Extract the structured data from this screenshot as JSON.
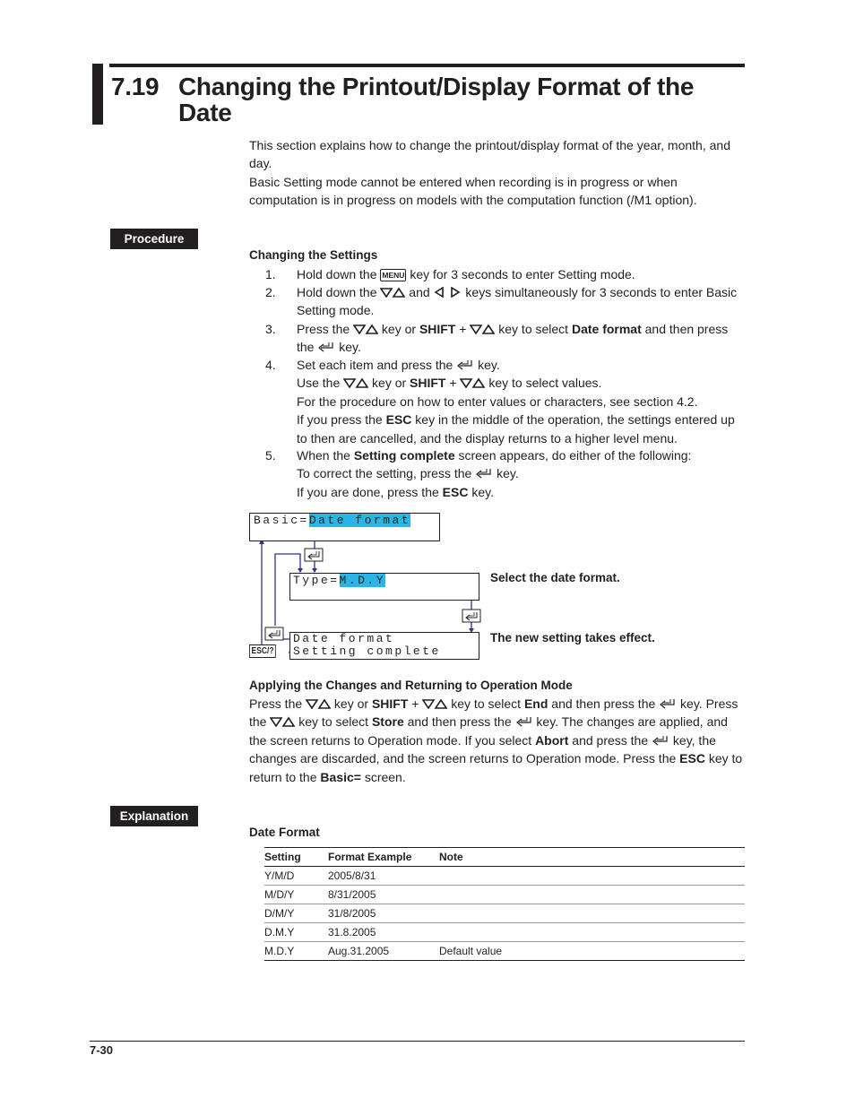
{
  "section": {
    "number": "7.19",
    "title": "Changing the Printout/Display Format of the Date"
  },
  "intro": {
    "line1": "This section explains how to change the printout/display format of the year, month, and day.",
    "line2": "Basic Setting mode cannot be entered when recording is in progress or when computation is in progress on models with the computation function (/M1 option)."
  },
  "tags": {
    "procedure": "Procedure",
    "explanation": "Explanation"
  },
  "keys": {
    "menu": "MENU",
    "shift": "SHIFT",
    "esc": "ESC",
    "esc_help": "ESC/?"
  },
  "procedure": {
    "heading": "Changing the Settings",
    "steps": [
      {
        "n": "1.",
        "a": "Hold down the ",
        "b": " key for 3 seconds to enter Setting mode."
      },
      {
        "n": "2.",
        "a": "Hold down the ",
        "b": " and ",
        "c": " keys simultaneously for 3 seconds to enter Basic Setting mode."
      },
      {
        "n": "3.",
        "a": "Press the ",
        "b": " key or ",
        "c": " + ",
        "d": " key to select ",
        "e": "Date format",
        "f": " and then press the ",
        "g": " key."
      },
      {
        "n": "4.",
        "a": "Set each item and press the ",
        "b": " key.",
        "c": "Use the ",
        "d": " key or ",
        "e": " + ",
        "f": " key to select values.",
        "g": "For the procedure on how to enter values or characters, see section 4.2.",
        "h": "If you press the ",
        "i": " key in the middle of the operation, the settings entered up to then are cancelled, and the display returns to a higher level menu."
      },
      {
        "n": "5.",
        "a": "When the ",
        "b": "Setting complete",
        "c": " screen appears, do either of the following:",
        "d": "To correct the setting, press the ",
        "e": " key.",
        "f": "If you are done, press the ",
        "g": " key."
      }
    ]
  },
  "diagram": {
    "screen1": {
      "prefix": "Basic=",
      "value": "Date format"
    },
    "screen2": {
      "prefix": "Type=",
      "value": "M.D.Y"
    },
    "screen3": {
      "line1": "Date format",
      "line2": "Setting complete"
    },
    "label_select": "Select the date format.",
    "label_effect": "The new setting takes effect.",
    "accent_color": "#29b5e6",
    "arrow_color": "#2e3192"
  },
  "applying": {
    "heading": "Applying the Changes and Returning to Operation Mode",
    "p1": "Press the ",
    "p2": " key or ",
    "p3": " + ",
    "p4": " key to select ",
    "end": "End",
    "p5": " and then press the ",
    "p6": " key.  Press the ",
    "p7": " key to select ",
    "store": "Store",
    "p8": " and then press the ",
    "p9": " key.  The changes are applied, and the screen returns to Operation mode.  If you select ",
    "abort": "Abort",
    "p10": " and press the ",
    "p11": " key, the changes are discarded, and the screen returns to Operation mode.  Press the ",
    "p12": " key to return to the ",
    "basic": "Basic=",
    "p13": " screen."
  },
  "explanation": {
    "heading": "Date Format",
    "table": {
      "headers": [
        "Setting",
        "Format Example",
        "Note"
      ],
      "rows": [
        [
          "Y/M/D",
          "2005/8/31",
          ""
        ],
        [
          "M/D/Y",
          "8/31/2005",
          ""
        ],
        [
          "D/M/Y",
          "31/8/2005",
          ""
        ],
        [
          "D.M.Y",
          "31.8.2005",
          ""
        ],
        [
          "M.D.Y",
          "Aug.31.2005",
          "Default value"
        ]
      ]
    }
  },
  "footer": {
    "page": "7-30"
  }
}
